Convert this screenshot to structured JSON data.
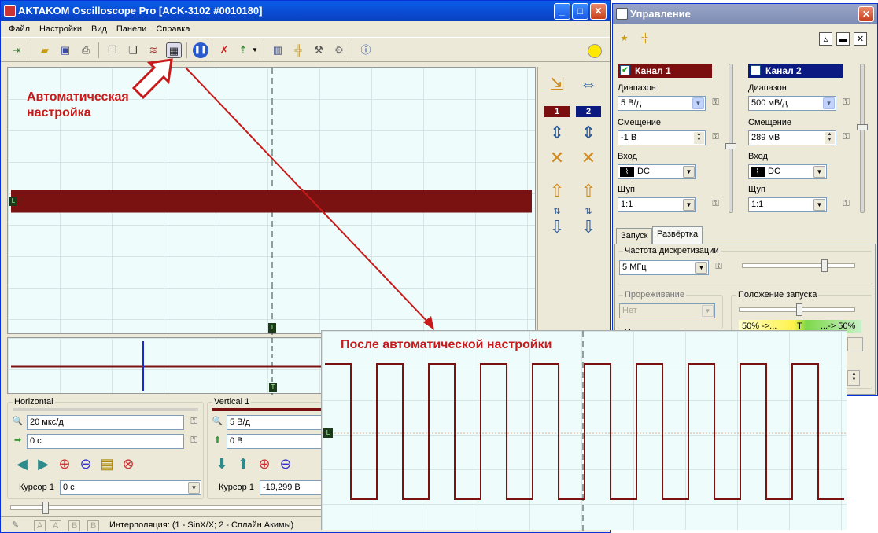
{
  "main_window": {
    "title": "AKTAKOM Oscilloscope Pro [ACK-3102 #0010180]",
    "menu": [
      "Файл",
      "Настройки",
      "Вид",
      "Панели",
      "Справка"
    ],
    "status_text": "Интерполяция: (1 - SinX/X; 2 - Сплайн Акимы)",
    "status_channels": [
      "A",
      "A",
      "B",
      "B"
    ]
  },
  "annotations": {
    "auto_setup": "Автоматическая настройка",
    "after_auto_setup": "После автоматической настройки"
  },
  "scope": {
    "channel_buttons": [
      "1",
      "2"
    ],
    "trigger_marker": "T",
    "ground_marker": "L"
  },
  "horizontal": {
    "title": "Horizontal",
    "timebase": "20 мкс/д",
    "offset": "0 с",
    "cursor_label": "Курсор 1",
    "cursor_value": "0 с"
  },
  "vertical": {
    "title": "Vertical 1",
    "scale": "5 В/д",
    "offset": "0 В",
    "cursor_label": "Курсор 1",
    "cursor_value": "-19,299 В"
  },
  "control_window": {
    "title": "Управление",
    "ch1": {
      "name": "Канал 1",
      "range_label": "Диапазон",
      "range": "5 В/д",
      "offset_label": "Смещение",
      "offset": "-1 В",
      "input_label": "Вход",
      "input": "DC",
      "probe_label": "Щуп",
      "probe": "1:1",
      "color": "#7b0f0f"
    },
    "ch2": {
      "name": "Канал 2",
      "range_label": "Диапазон",
      "range": "500 мВ/д",
      "offset_label": "Смещение",
      "offset": "289 мВ",
      "input_label": "Вход",
      "input": "DC",
      "probe_label": "Щуп",
      "probe": "1:1",
      "color": "#0a1a80"
    },
    "tabs": [
      "Запуск",
      "Развёртка"
    ],
    "sample_rate_label": "Частота дискретизации",
    "sample_rate": "5 МГц",
    "decimation_label": "Прореживание",
    "decimation": "Нет",
    "interpolation_label": "Интерполяция",
    "trigger_pos_label": "Положение запуска",
    "trigger_pos_left": "50% ->...",
    "trigger_pos_mid": "T",
    "trigger_pos_right": "...-> 50%"
  },
  "colors": {
    "trace": "#7b1212",
    "annotation": "#c81a1a",
    "scope_bg": "#eefcfc",
    "title_bar": "#0a4fd6"
  }
}
